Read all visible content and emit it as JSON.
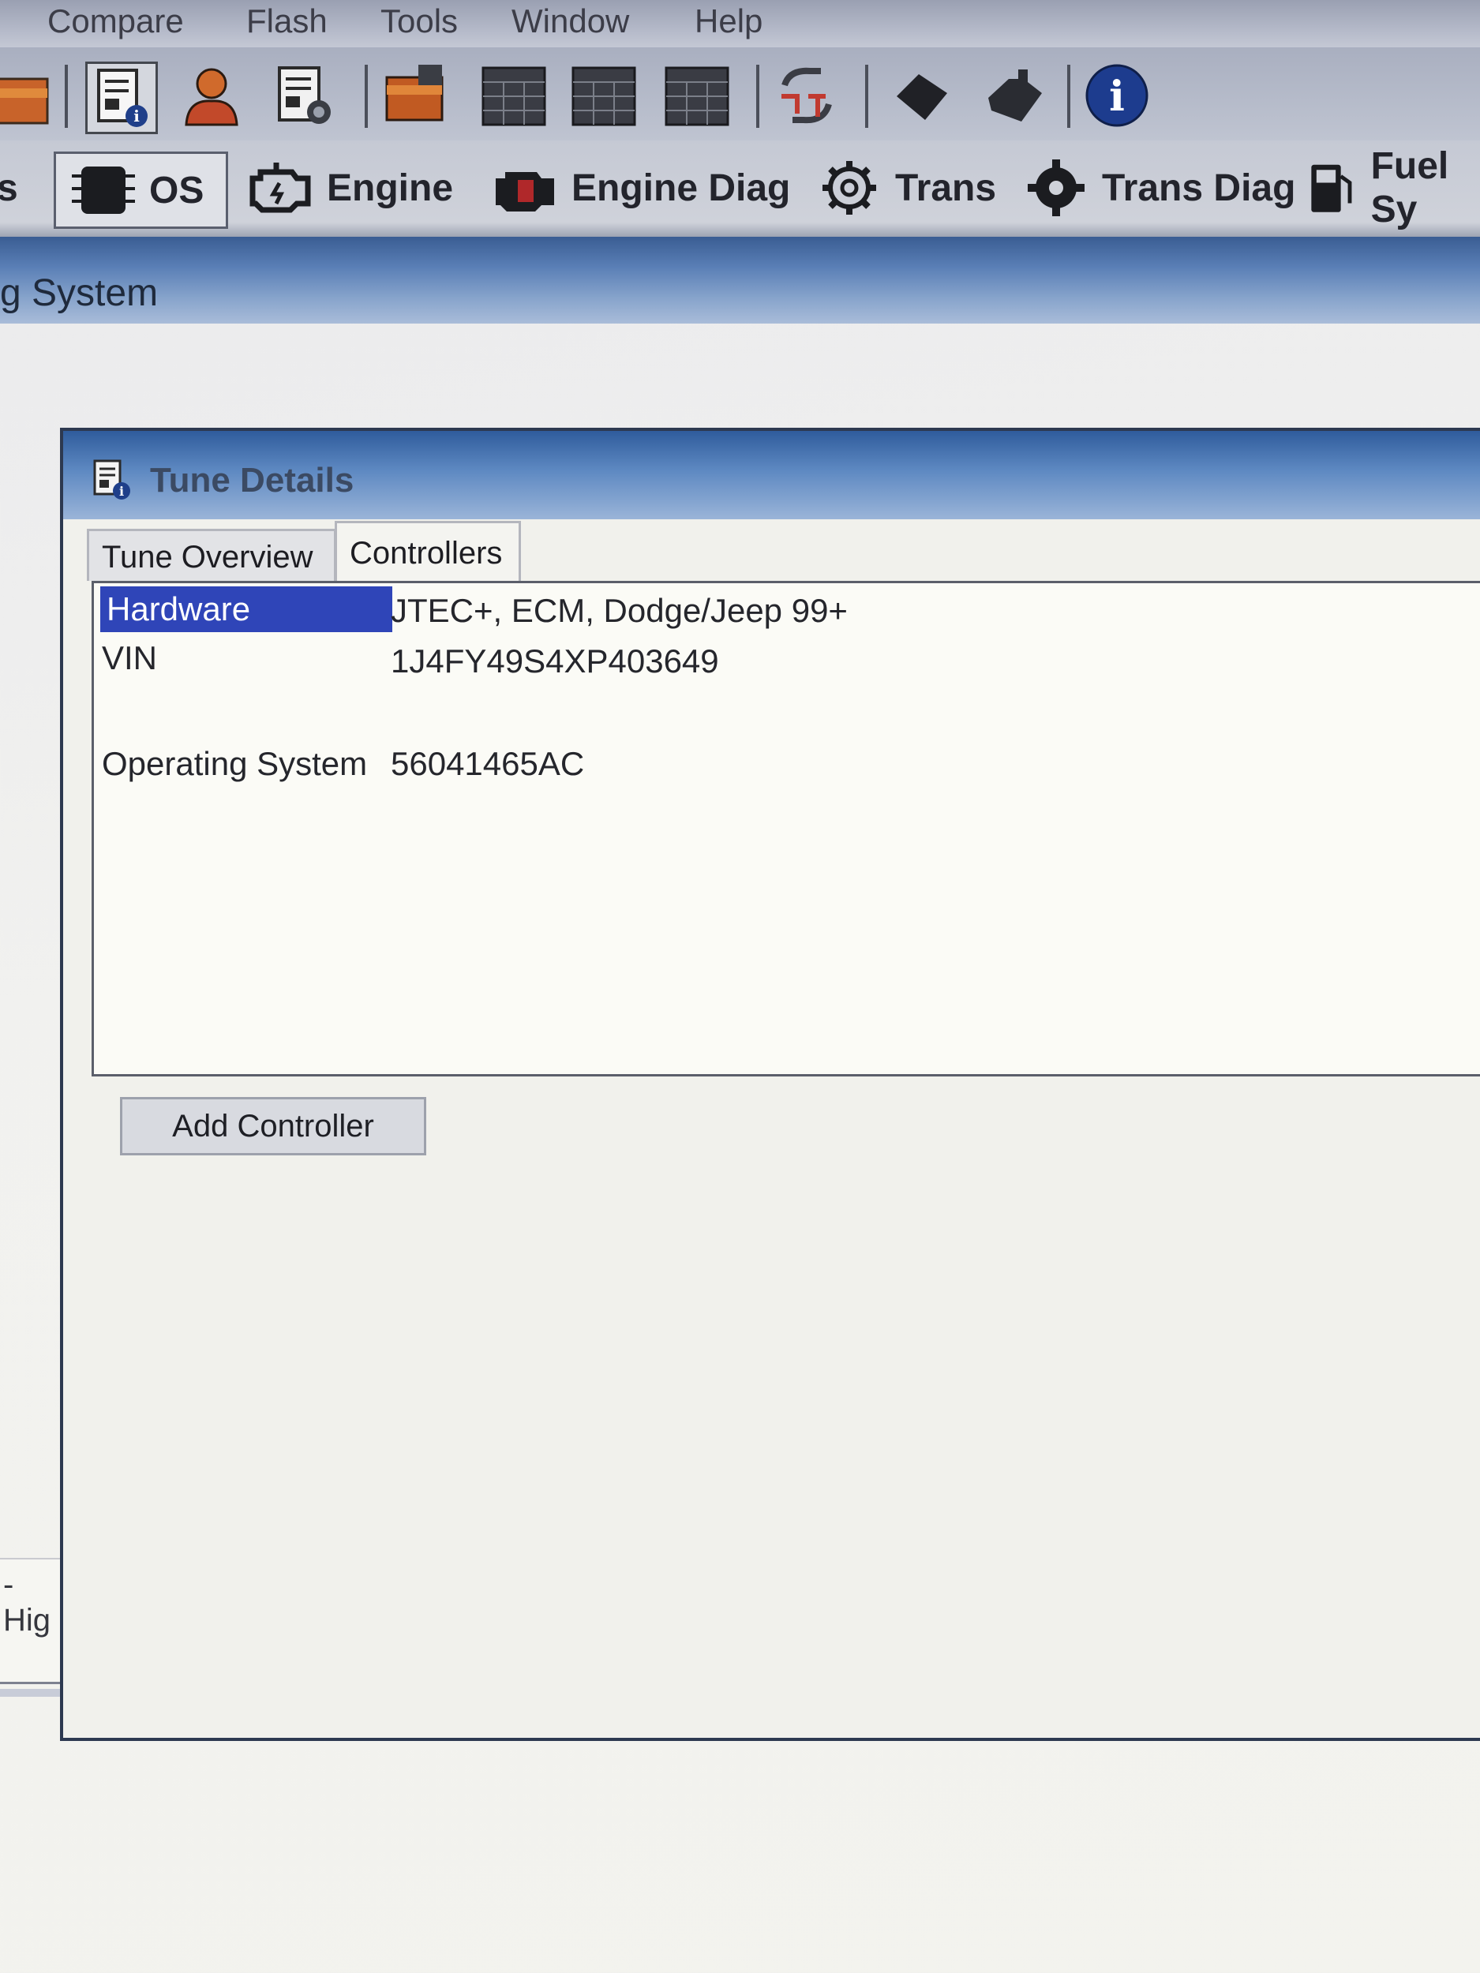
{
  "menu": {
    "items": [
      "Compare",
      "Flash",
      "Tools",
      "Window",
      "Help"
    ]
  },
  "toolbar": {
    "icons": [
      "open-folder-icon",
      "tune-info-icon",
      "user-icon",
      "vehicle-info-icon",
      "folder-save-icon",
      "table-icon",
      "table-icon",
      "table-icon",
      "sync-icon",
      "engine-block-icon",
      "engine-block-icon",
      "info-icon"
    ]
  },
  "modules": {
    "partial_left": "s",
    "os": "OS",
    "engine": "Engine",
    "engine_diag": "Engine Diag",
    "trans": "Trans",
    "trans_diag": "Trans Diag",
    "fuel": "Fuel Sy"
  },
  "doc_window": {
    "title_fragment": "g System"
  },
  "dialog": {
    "title": "Tune Details",
    "tabs": {
      "overview": "Tune Overview",
      "controllers": "Controllers"
    },
    "rows": {
      "hardware_label": "Hardware",
      "hardware_value": "JTEC+, ECM, Dodge/Jeep 99+",
      "vin_label": "VIN",
      "vin_value": "1J4FY49S4XP403649",
      "os_label": "Operating System",
      "os_value": "56041465AC"
    },
    "add_controller": "Add Controller"
  },
  "background": {
    "fragment_text": "- Hig"
  },
  "colors": {
    "selection": "#2f45b8",
    "titlebar_blue": "#2f5c9c"
  }
}
